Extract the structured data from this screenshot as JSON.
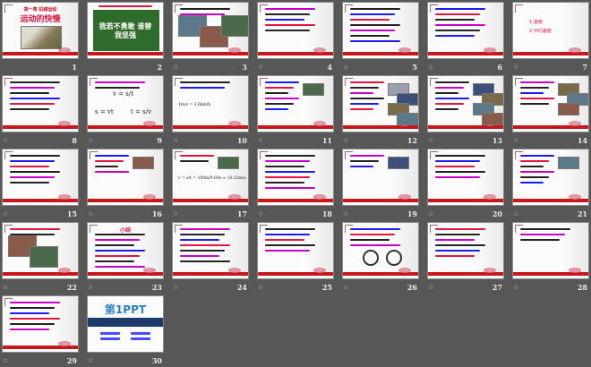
{
  "view": "slide-sorter",
  "colors": {
    "background": "#575757",
    "accent_red": "#c8161d",
    "text_red": "#e8143c",
    "text_blue": "#1a1aff",
    "text_magenta": "#cc00cc",
    "green_board": "#2f6b2a"
  },
  "slides": [
    {
      "number": "1",
      "layout": "cover",
      "kicker": "第一章 机械运动",
      "title": "运动的快慢",
      "photos": 1,
      "rows": 1
    },
    {
      "number": "2",
      "layout": "board",
      "kicker": "",
      "title": "我若不勇敢 谁替我坚强",
      "photos": 0,
      "rows": 1
    },
    {
      "number": "3",
      "layout": "photos",
      "kicker": "",
      "title": "",
      "photos": 3,
      "rows": 2
    },
    {
      "number": "4",
      "layout": "text",
      "kicker": "",
      "title": "",
      "photos": 0,
      "rows": 5
    },
    {
      "number": "5",
      "layout": "text",
      "kicker": "",
      "title": "",
      "photos": 0,
      "rows": 7
    },
    {
      "number": "6",
      "layout": "text",
      "kicker": "",
      "title": "",
      "photos": 0,
      "rows": 6
    },
    {
      "number": "7",
      "layout": "list",
      "kicker": "",
      "title": "",
      "items": [
        "1.速度",
        "2.平均速度"
      ],
      "photos": 0,
      "rows": 0
    },
    {
      "number": "8",
      "layout": "text",
      "kicker": "",
      "title": "",
      "photos": 0,
      "rows": 6
    },
    {
      "number": "9",
      "layout": "formula",
      "kicker": "",
      "title": "",
      "formulas": [
        "v = s/t",
        "s = vt",
        "t = s/v"
      ],
      "photos": 0,
      "rows": 2
    },
    {
      "number": "10",
      "layout": "formula",
      "kicker": "",
      "title": "",
      "formulas": [
        "1m/s = 3.6km/h"
      ],
      "photos": 0,
      "rows": 4
    },
    {
      "number": "11",
      "layout": "textphoto",
      "kicker": "",
      "title": "",
      "photos": 1,
      "rows": 6
    },
    {
      "number": "12",
      "layout": "table",
      "kicker": "",
      "title": "",
      "photos": 4,
      "rows": 6
    },
    {
      "number": "13",
      "layout": "table",
      "kicker": "",
      "title": "",
      "photos": 4,
      "rows": 6
    },
    {
      "number": "14",
      "layout": "textphoto",
      "kicker": "",
      "title": "",
      "photos": 3,
      "rows": 5
    },
    {
      "number": "15",
      "layout": "text",
      "kicker": "",
      "title": "",
      "photos": 0,
      "rows": 6
    },
    {
      "number": "16",
      "layout": "textphoto",
      "kicker": "",
      "title": "",
      "photos": 1,
      "rows": 4
    },
    {
      "number": "17",
      "layout": "formula",
      "kicker": "",
      "title": "",
      "formulas": [
        "v = s/t = 100m/9.69s ≈ 10.32m/s"
      ],
      "photos": 1,
      "rows": 2
    },
    {
      "number": "18",
      "layout": "text",
      "kicker": "",
      "title": "",
      "photos": 0,
      "rows": 7
    },
    {
      "number": "19",
      "layout": "textphoto",
      "kicker": "",
      "title": "",
      "photos": 1,
      "rows": 3
    },
    {
      "number": "20",
      "layout": "text",
      "kicker": "",
      "title": "",
      "photos": 0,
      "rows": 5
    },
    {
      "number": "21",
      "layout": "textphoto",
      "kicker": "",
      "title": "",
      "photos": 1,
      "rows": 6
    },
    {
      "number": "22",
      "layout": "photos",
      "kicker": "",
      "title": "",
      "photos": 2,
      "rows": 2
    },
    {
      "number": "23",
      "layout": "text",
      "kicker": "",
      "title": "小结",
      "photos": 0,
      "rows": 7
    },
    {
      "number": "24",
      "layout": "text",
      "kicker": "",
      "title": "",
      "photos": 0,
      "rows": 7
    },
    {
      "number": "25",
      "layout": "text",
      "kicker": "",
      "title": "",
      "photos": 0,
      "rows": 5
    },
    {
      "number": "26",
      "layout": "clocks",
      "kicker": "",
      "title": "",
      "photos": 0,
      "rows": 4
    },
    {
      "number": "27",
      "layout": "text",
      "kicker": "",
      "title": "",
      "photos": 0,
      "rows": 6
    },
    {
      "number": "28",
      "layout": "text",
      "kicker": "",
      "title": "",
      "photos": 0,
      "rows": 3
    },
    {
      "number": "29",
      "layout": "text",
      "kicker": "",
      "title": "",
      "photos": 0,
      "rows": 6
    },
    {
      "number": "30",
      "layout": "ppt",
      "kicker": "",
      "title": "第1PPT",
      "photos": 0,
      "rows": 4
    }
  ]
}
